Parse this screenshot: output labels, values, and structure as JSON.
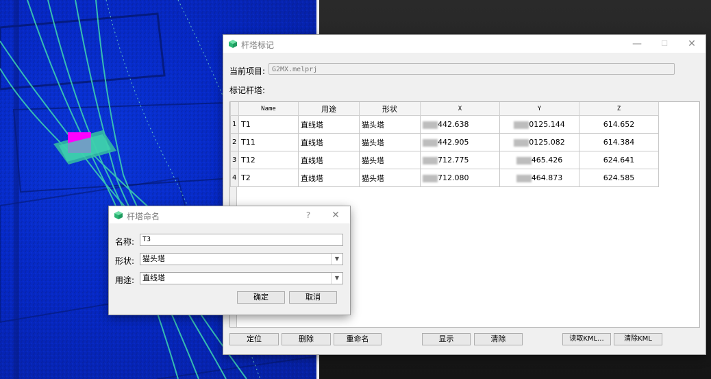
{
  "main_window": {
    "title": "杆塔标记",
    "project_label": "当前项目:",
    "project_value": "G2MX.melprj",
    "towers_label": "标记杆塔:",
    "columns": [
      "Name",
      "用途",
      "形状",
      "X",
      "Y",
      "Z"
    ],
    "rows": [
      {
        "index": "1",
        "name": "T1",
        "purpose": "直线塔",
        "shape": "猫头塔",
        "x": "442.638",
        "y": "0125.144",
        "z": "614.652"
      },
      {
        "index": "2",
        "name": "T11",
        "purpose": "直线塔",
        "shape": "猫头塔",
        "x": "442.905",
        "y": "0125.082",
        "z": "614.384"
      },
      {
        "index": "3",
        "name": "T12",
        "purpose": "直线塔",
        "shape": "猫头塔",
        "x": "712.775",
        "y": "465.426",
        "z": "624.641"
      },
      {
        "index": "4",
        "name": "T2",
        "purpose": "直线塔",
        "shape": "猫头塔",
        "x": "712.080",
        "y": "464.873",
        "z": "624.585"
      }
    ],
    "buttons": {
      "locate": "定位",
      "delete": "删除",
      "rename": "重命名",
      "show": "显示",
      "clear": "清除",
      "read_kml": "读取KML...",
      "clear_kml": "清除KML"
    },
    "controls": {
      "minimize": "—",
      "maximize": "☐",
      "close": "✕"
    }
  },
  "rename_dialog": {
    "title": "杆塔命名",
    "help": "?",
    "close": "✕",
    "name_label": "名称:",
    "name_value": "T3",
    "shape_label": "形状:",
    "shape_value": "猫头塔",
    "purpose_label": "用途:",
    "purpose_value": "直线塔",
    "ok": "确定",
    "cancel": "取消"
  },
  "colors": {
    "accent_icon": "#2bb673",
    "point_cloud_blue": "#0628c4",
    "power_line_green": "#3fd6b0",
    "marker_magenta": "#ff00ff"
  }
}
